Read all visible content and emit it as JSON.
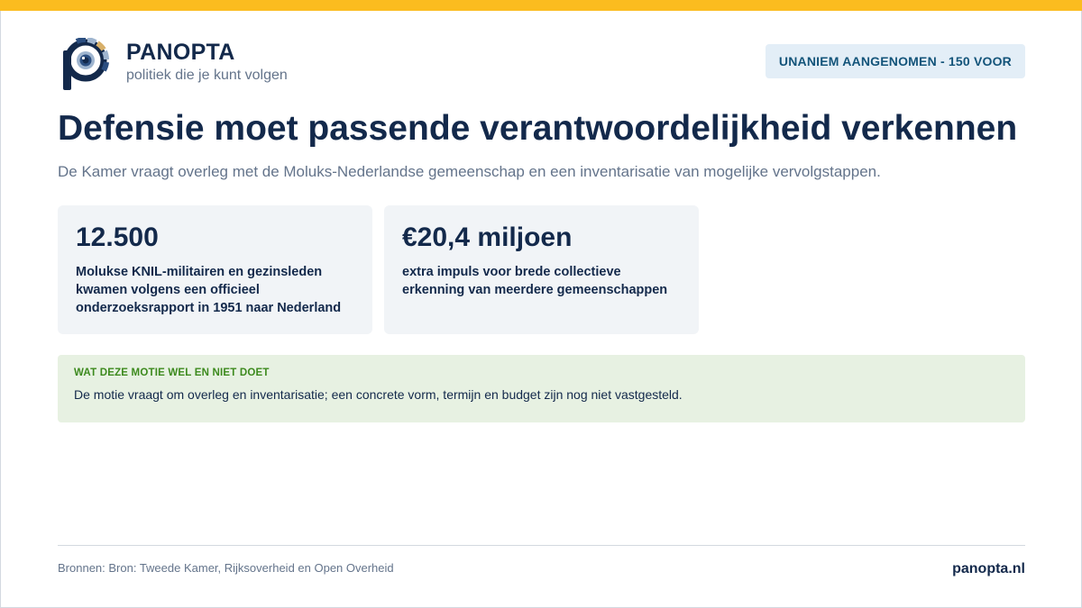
{
  "brand": {
    "name": "PANOPTA",
    "tagline": "politiek die je kunt volgen",
    "logo_icon": "panopta-eye-p-logo",
    "colors": {
      "accent": "#fbbc1f",
      "navy": "#13294b",
      "steel": "#2b4e80",
      "light_blue": "#9fb5cf",
      "sand": "#d8b06a"
    }
  },
  "badge": {
    "label": "UNANIEM AANGENOMEN - 150 VOOR"
  },
  "headline": {
    "title": "Defensie moet passende verantwoordelijkheid verkennen",
    "subtitle": "De Kamer vraagt overleg met de Moluks-Nederlandse gemeenschap en een inventarisatie van mogelijke vervolgstappen."
  },
  "stats": [
    {
      "value": "12.500",
      "description": "Molukse KNIL-militairen en gezinsleden kwamen volgens een officieel onderzoeksrapport in 1951 naar Nederland"
    },
    {
      "value": "€20,4 miljoen",
      "description": "extra impuls voor brede collectieve erkenning van meerdere gemeenschappen"
    }
  ],
  "note": {
    "label": "WAT DEZE MOTIE WEL EN NIET DOET",
    "text": "De motie vraagt om overleg en inventarisatie; een concrete vorm, termijn en budget zijn nog niet vastgesteld."
  },
  "footer": {
    "sources": "Bronnen: Bron: Tweede Kamer, Rijksoverheid en Open Overheid",
    "site": "panopta.nl"
  }
}
